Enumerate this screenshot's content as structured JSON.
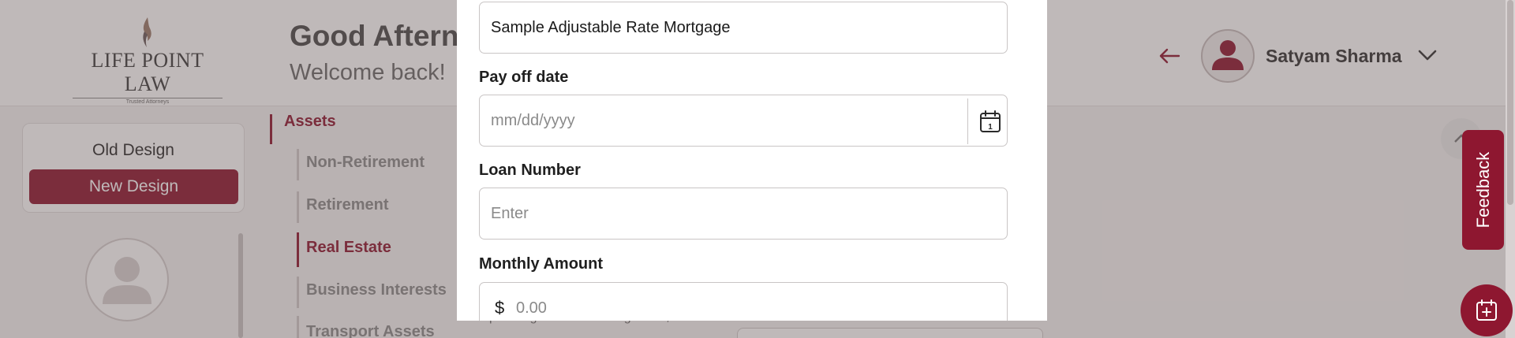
{
  "brand": {
    "name": "LIFE POINT LAW",
    "tagline": "Trusted Attorneys"
  },
  "header": {
    "greeting": "Good Aftern",
    "subtitle": "Welcome back!",
    "user_name": "Satyam Sharma",
    "icons": [
      "back-arrow-icon",
      "user-avatar-icon",
      "chevron-down-icon"
    ]
  },
  "design_toggle": {
    "old_label": "Old Design",
    "new_label": "New Design"
  },
  "nav": {
    "group": "Assets",
    "items": [
      {
        "label": "Non-Retirement",
        "active": false
      },
      {
        "label": "Retirement",
        "active": false
      },
      {
        "label": "Real Estate",
        "active": true
      },
      {
        "label": "Business Interests",
        "active": false
      },
      {
        "label": "Transport Assets",
        "active": false
      }
    ]
  },
  "background": {
    "partial_text": "planning for asset management,"
  },
  "modal": {
    "name_field": {
      "value": "Sample Adjustable Rate Mortgage"
    },
    "payoff_date": {
      "label": "Pay off date",
      "placeholder": "mm/dd/yyyy"
    },
    "loan_number": {
      "label": "Loan Number",
      "placeholder": "Enter"
    },
    "monthly_amount": {
      "label": "Monthly Amount",
      "currency": "$",
      "placeholder": "0.00"
    }
  },
  "feedback": {
    "label": "Feedback"
  },
  "colors": {
    "brand": "#8e1730",
    "overlay": "rgba(95,80,80,0.40)"
  }
}
